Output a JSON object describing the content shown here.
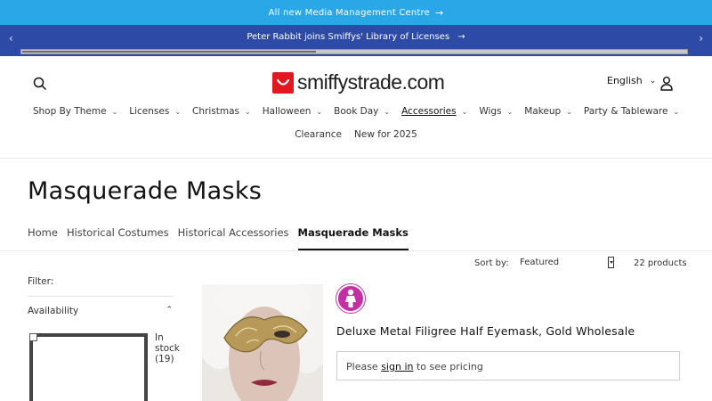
{
  "announcement1": {
    "text": "All new Media Management Centre",
    "arrow": "→"
  },
  "announcement2": {
    "text": "Peter Rabbit joins Smiffys' Library of Licenses",
    "arrow": "→",
    "prev": "‹",
    "next": "›"
  },
  "header": {
    "logo_text": "smiffystrade.com",
    "language": "English",
    "language_chevron": "⌄",
    "icons": {
      "search": "search-icon",
      "account": "account-icon",
      "logo": "smile-logo-icon"
    },
    "brand_color": "#e3171f"
  },
  "nav": {
    "row1": [
      {
        "label": "Shop By Theme"
      },
      {
        "label": "Licenses"
      },
      {
        "label": "Christmas"
      },
      {
        "label": "Halloween"
      },
      {
        "label": "Book Day"
      },
      {
        "label": "Accessories"
      },
      {
        "label": "Wigs"
      },
      {
        "label": "Makeup"
      },
      {
        "label": "Party & Tableware"
      }
    ],
    "row2": [
      {
        "label": "Clearance"
      },
      {
        "label": "New for 2025"
      }
    ],
    "chevron": "⌄"
  },
  "page": {
    "title": "Masquerade Masks"
  },
  "breadcrumbs": [
    "Home",
    "Historical Costumes",
    "Historical Accessories",
    "Masquerade Masks"
  ],
  "sort": {
    "label": "Sort by:",
    "value": "Featured",
    "count": "22 products"
  },
  "filter": {
    "label": "Filter:",
    "availability": "Availability",
    "chevron": "⌃",
    "instock_line1": "In",
    "instock_line2": "stock",
    "instock_line3": "(19)"
  },
  "product": {
    "badge_icon": "female-icon",
    "badge_color": "#c52fa6",
    "title": "Deluxe Metal Filigree Half Eyemask, Gold Wholesale",
    "pricing_prefix": "Please ",
    "pricing_link": "sign in",
    "pricing_suffix": " to see pricing"
  },
  "colors": {
    "announcement1_bg": "#2aa7e6",
    "announcement2_bg": "#2d4aa6"
  }
}
